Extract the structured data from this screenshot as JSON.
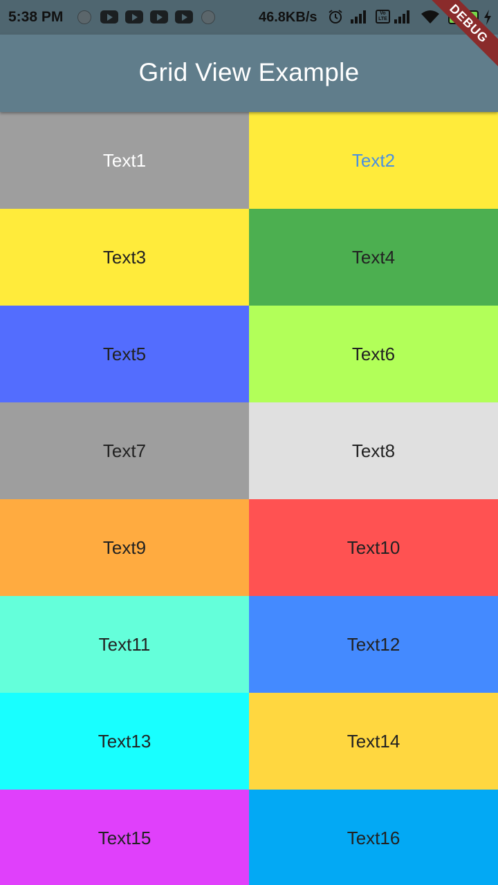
{
  "status_bar": {
    "time": "5:38 PM",
    "speed": "46.8KB/s",
    "volte": "Vo LTE",
    "battery": "67"
  },
  "app_bar": {
    "title": "Grid View Example"
  },
  "debug_banner": "DEBUG",
  "grid": [
    {
      "label": "Text1",
      "bg": "#9e9e9e",
      "text_color": "#ffffff"
    },
    {
      "label": "Text2",
      "bg": "#ffeb3b",
      "text_color": "#4a90e2"
    },
    {
      "label": "Text3",
      "bg": "#ffeb3b",
      "text_color": "#222222"
    },
    {
      "label": "Text4",
      "bg": "#4caf50",
      "text_color": "#222222"
    },
    {
      "label": "Text5",
      "bg": "#536dfe",
      "text_color": "#222222"
    },
    {
      "label": "Text6",
      "bg": "#b2ff59",
      "text_color": "#222222"
    },
    {
      "label": "Text7",
      "bg": "#9e9e9e",
      "text_color": "#222222"
    },
    {
      "label": "Text8",
      "bg": "#e0e0e0",
      "text_color": "#222222"
    },
    {
      "label": "Text9",
      "bg": "#ffab40",
      "text_color": "#222222"
    },
    {
      "label": "Text10",
      "bg": "#ff5252",
      "text_color": "#222222"
    },
    {
      "label": "Text11",
      "bg": "#64ffda",
      "text_color": "#222222"
    },
    {
      "label": "Text12",
      "bg": "#448aff",
      "text_color": "#222222"
    },
    {
      "label": "Text13",
      "bg": "#18ffff",
      "text_color": "#222222"
    },
    {
      "label": "Text14",
      "bg": "#ffd740",
      "text_color": "#222222"
    },
    {
      "label": "Text15",
      "bg": "#e040fb",
      "text_color": "#222222"
    },
    {
      "label": "Text16",
      "bg": "#03a9f4",
      "text_color": "#222222"
    }
  ]
}
